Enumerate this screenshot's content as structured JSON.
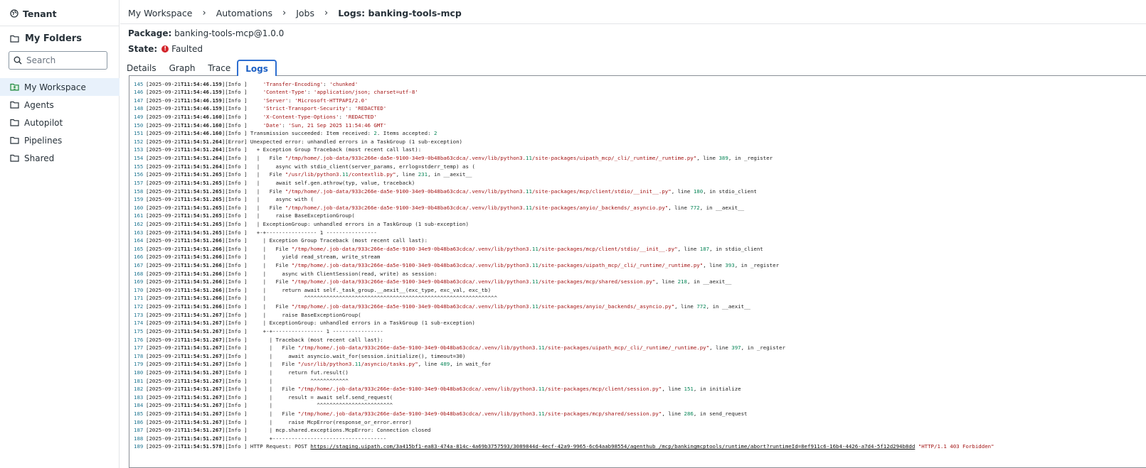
{
  "sidebar": {
    "tenant_label": "Tenant",
    "my_folders_label": "My Folders",
    "search_placeholder": "Search",
    "items": [
      {
        "label": "My Workspace",
        "icon": "folder-user-icon",
        "active": true
      },
      {
        "label": "Agents",
        "icon": "folder-icon",
        "active": false
      },
      {
        "label": "Autopilot",
        "icon": "folder-icon",
        "active": false
      },
      {
        "label": "Pipelines",
        "icon": "folder-icon",
        "active": false
      },
      {
        "label": "Shared",
        "icon": "folder-icon",
        "active": false
      }
    ]
  },
  "breadcrumb": [
    "My Workspace",
    "Automations",
    "Jobs",
    "Logs: banking-tools-mcp"
  ],
  "job": {
    "package_label": "Package:",
    "package_value": "banking-tools-mcp@1.0.0",
    "state_label": "State:",
    "state_value": "Faulted"
  },
  "tabs": [
    {
      "label": "Details",
      "active": false
    },
    {
      "label": "Graph",
      "active": false
    },
    {
      "label": "Trace",
      "active": false
    },
    {
      "label": "Logs",
      "active": true
    }
  ],
  "colors": {
    "accent": "#2e6fd1",
    "faulted": "#d3252b",
    "active_bg": "#e8f1fb"
  },
  "log_prefix_date": "2025-09-21",
  "log_lines": [
    {
      "n": "145",
      "t": "11:54:46.159",
      "lvl": "Info ",
      "msg": "    'Transfer-Encoding': 'chunked'"
    },
    {
      "n": "146",
      "t": "11:54:46.159",
      "lvl": "Info ",
      "msg": "    'Content-Type': 'application/json; charset=utf-8'"
    },
    {
      "n": "147",
      "t": "11:54:46.159",
      "lvl": "Info ",
      "msg": "    'Server': 'Microsoft-HTTPAPI/2.0'"
    },
    {
      "n": "148",
      "t": "11:54:46.159",
      "lvl": "Info ",
      "msg": "    'Strict-Transport-Security': 'REDACTED'"
    },
    {
      "n": "149",
      "t": "11:54:46.160",
      "lvl": "Info ",
      "msg": "    'X-Content-Type-Options': 'REDACTED'"
    },
    {
      "n": "150",
      "t": "11:54:46.160",
      "lvl": "Info ",
      "msg": "    'Date': 'Sun, 21 Sep 2025 11:54:46 GMT'"
    },
    {
      "n": "151",
      "t": "11:54:46.160",
      "lvl": "Info ",
      "msg": "Transmission succeeded: Item received: 2. Items accepted: 2"
    },
    {
      "n": "152",
      "t": "11:54:51.264",
      "lvl": "Error",
      "msg": "Unexpected error: unhandled errors in a TaskGroup (1 sub-exception)"
    },
    {
      "n": "153",
      "t": "11:54:51.264",
      "lvl": "Info ",
      "msg": "  + Exception Group Traceback (most recent call last):"
    },
    {
      "n": "154",
      "t": "11:54:51.264",
      "lvl": "Info ",
      "msg": "  |   File \"/tmp/home/.job-data/933c266e-da5e-9100-34e9-0b48ba63cdca/.venv/lib/python3.11/site-packages/uipath_mcp/_cli/_runtime/_runtime.py\", line 389, in _register"
    },
    {
      "n": "155",
      "t": "11:54:51.264",
      "lvl": "Info ",
      "msg": "  |     async with stdio_client(server_params, errlog=stderr_temp) as ("
    },
    {
      "n": "156",
      "t": "11:54:51.265",
      "lvl": "Info ",
      "msg": "  |   File \"/usr/lib/python3.11/contextlib.py\", line 231, in __aexit__"
    },
    {
      "n": "157",
      "t": "11:54:51.265",
      "lvl": "Info ",
      "msg": "  |     await self.gen.athrow(typ, value, traceback)"
    },
    {
      "n": "158",
      "t": "11:54:51.265",
      "lvl": "Info ",
      "msg": "  |   File \"/tmp/home/.job-data/933c266e-da5e-9100-34e9-0b48ba63cdca/.venv/lib/python3.11/site-packages/mcp/client/stdio/__init__.py\", line 180, in stdio_client"
    },
    {
      "n": "159",
      "t": "11:54:51.265",
      "lvl": "Info ",
      "msg": "  |     async with ("
    },
    {
      "n": "160",
      "t": "11:54:51.265",
      "lvl": "Info ",
      "msg": "  |   File \"/tmp/home/.job-data/933c266e-da5e-9100-34e9-0b48ba63cdca/.venv/lib/python3.11/site-packages/anyio/_backends/_asyncio.py\", line 772, in __aexit__"
    },
    {
      "n": "161",
      "t": "11:54:51.265",
      "lvl": "Info ",
      "msg": "  |     raise BaseExceptionGroup("
    },
    {
      "n": "162",
      "t": "11:54:51.265",
      "lvl": "Info ",
      "msg": "  | ExceptionGroup: unhandled errors in a TaskGroup (1 sub-exception)"
    },
    {
      "n": "163",
      "t": "11:54:51.265",
      "lvl": "Info ",
      "msg": "  +-+---------------- 1 ----------------"
    },
    {
      "n": "164",
      "t": "11:54:51.266",
      "lvl": "Info ",
      "msg": "    | Exception Group Traceback (most recent call last):"
    },
    {
      "n": "165",
      "t": "11:54:51.266",
      "lvl": "Info ",
      "msg": "    |   File \"/tmp/home/.job-data/933c266e-da5e-9100-34e9-0b48ba63cdca/.venv/lib/python3.11/site-packages/mcp/client/stdio/__init__.py\", line 187, in stdio_client"
    },
    {
      "n": "166",
      "t": "11:54:51.266",
      "lvl": "Info ",
      "msg": "    |     yield read_stream, write_stream"
    },
    {
      "n": "167",
      "t": "11:54:51.266",
      "lvl": "Info ",
      "msg": "    |   File \"/tmp/home/.job-data/933c266e-da5e-9100-34e9-0b48ba63cdca/.venv/lib/python3.11/site-packages/uipath_mcp/_cli/_runtime/_runtime.py\", line 393, in _register"
    },
    {
      "n": "168",
      "t": "11:54:51.266",
      "lvl": "Info ",
      "msg": "    |     async with ClientSession(read, write) as session:"
    },
    {
      "n": "169",
      "t": "11:54:51.266",
      "lvl": "Info ",
      "msg": "    |   File \"/tmp/home/.job-data/933c266e-da5e-9100-34e9-0b48ba63cdca/.venv/lib/python3.11/site-packages/mcp/shared/session.py\", line 218, in __aexit__"
    },
    {
      "n": "170",
      "t": "11:54:51.266",
      "lvl": "Info ",
      "msg": "    |     return await self._task_group.__aexit__(exc_type, exc_val, exc_tb)"
    },
    {
      "n": "171",
      "t": "11:54:51.266",
      "lvl": "Info ",
      "msg": "    |            ^^^^^^^^^^^^^^^^^^^^^^^^^^^^^^^^^^^^^^^^^^^^^^^^^^^^^^^^^^^^^"
    },
    {
      "n": "172",
      "t": "11:54:51.266",
      "lvl": "Info ",
      "msg": "    |   File \"/tmp/home/.job-data/933c266e-da5e-9100-34e9-0b48ba63cdca/.venv/lib/python3.11/site-packages/anyio/_backends/_asyncio.py\", line 772, in __aexit__"
    },
    {
      "n": "173",
      "t": "11:54:51.267",
      "lvl": "Info ",
      "msg": "    |     raise BaseExceptionGroup("
    },
    {
      "n": "174",
      "t": "11:54:51.267",
      "lvl": "Info ",
      "msg": "    | ExceptionGroup: unhandled errors in a TaskGroup (1 sub-exception)"
    },
    {
      "n": "175",
      "t": "11:54:51.267",
      "lvl": "Info ",
      "msg": "    +-+---------------- 1 ----------------"
    },
    {
      "n": "176",
      "t": "11:54:51.267",
      "lvl": "Info ",
      "msg": "      | Traceback (most recent call last):"
    },
    {
      "n": "177",
      "t": "11:54:51.267",
      "lvl": "Info ",
      "msg": "      |   File \"/tmp/home/.job-data/933c266e-da5e-9100-34e9-0b48ba63cdca/.venv/lib/python3.11/site-packages/uipath_mcp/_cli/_runtime/_runtime.py\", line 397, in _register"
    },
    {
      "n": "178",
      "t": "11:54:51.267",
      "lvl": "Info ",
      "msg": "      |     await asyncio.wait_for(session.initialize(), timeout=30)"
    },
    {
      "n": "179",
      "t": "11:54:51.267",
      "lvl": "Info ",
      "msg": "      |   File \"/usr/lib/python3.11/asyncio/tasks.py\", line 489, in wait_for"
    },
    {
      "n": "180",
      "t": "11:54:51.267",
      "lvl": "Info ",
      "msg": "      |     return fut.result()"
    },
    {
      "n": "181",
      "t": "11:54:51.267",
      "lvl": "Info ",
      "msg": "      |            ^^^^^^^^^^^^"
    },
    {
      "n": "182",
      "t": "11:54:51.267",
      "lvl": "Info ",
      "msg": "      |   File \"/tmp/home/.job-data/933c266e-da5e-9100-34e9-0b48ba63cdca/.venv/lib/python3.11/site-packages/mcp/client/session.py\", line 151, in initialize"
    },
    {
      "n": "183",
      "t": "11:54:51.267",
      "lvl": "Info ",
      "msg": "      |     result = await self.send_request("
    },
    {
      "n": "184",
      "t": "11:54:51.267",
      "lvl": "Info ",
      "msg": "      |              ^^^^^^^^^^^^^^^^^^^^^^^^"
    },
    {
      "n": "185",
      "t": "11:54:51.267",
      "lvl": "Info ",
      "msg": "      |   File \"/tmp/home/.job-data/933c266e-da5e-9100-34e9-0b48ba63cdca/.venv/lib/python3.11/site-packages/mcp/shared/session.py\", line 286, in send_request"
    },
    {
      "n": "186",
      "t": "11:54:51.267",
      "lvl": "Info ",
      "msg": "      |     raise McpError(response_or_error.error)"
    },
    {
      "n": "187",
      "t": "11:54:51.267",
      "lvl": "Info ",
      "msg": "      | mcp.shared.exceptions.McpError: Connection closed"
    },
    {
      "n": "188",
      "t": "11:54:51.267",
      "lvl": "Info ",
      "msg": "      +------------------------------------"
    },
    {
      "n": "189",
      "t": "11:54:51.578",
      "lvl": "Info ",
      "msg": "HTTP Request: POST https://staging.uipath.com/3a415bf1-ea83-474a-814c-4a69b3757593/3089844d-4ecf-42a9-9965-6c64aab98554/agenthub_/mcp/bankingmcptools/runtime/abort?runtimeId=8ef911c6-16b4-4426-a7d4-5f12d294b8dd \"HTTP/1.1 403 Forbidden\""
    }
  ]
}
